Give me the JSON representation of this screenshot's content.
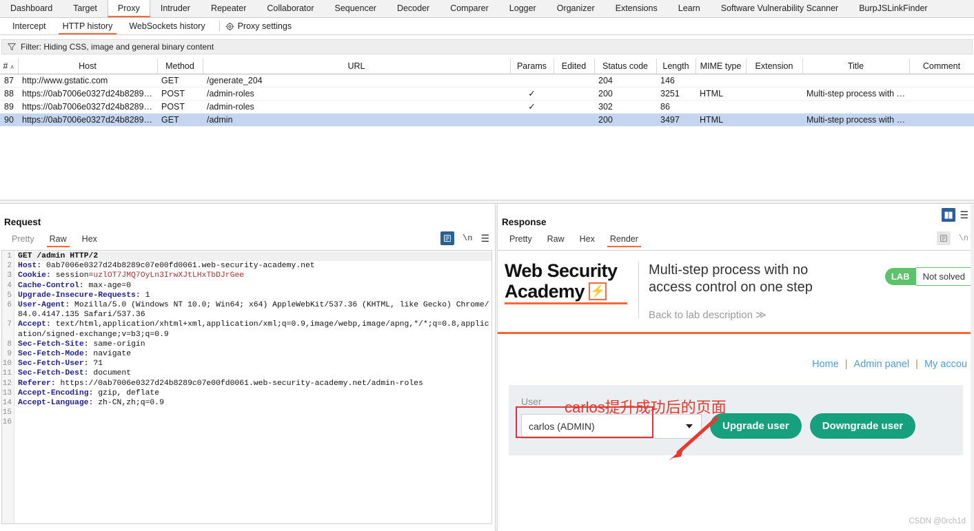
{
  "main_tabs": [
    {
      "label": "Dashboard",
      "active": false
    },
    {
      "label": "Target",
      "active": false
    },
    {
      "label": "Proxy",
      "active": true
    },
    {
      "label": "Intruder",
      "active": false
    },
    {
      "label": "Repeater",
      "active": false
    },
    {
      "label": "Collaborator",
      "active": false
    },
    {
      "label": "Sequencer",
      "active": false
    },
    {
      "label": "Decoder",
      "active": false
    },
    {
      "label": "Comparer",
      "active": false
    },
    {
      "label": "Logger",
      "active": false
    },
    {
      "label": "Organizer",
      "active": false
    },
    {
      "label": "Extensions",
      "active": false
    },
    {
      "label": "Learn",
      "active": false
    },
    {
      "label": "Software Vulnerability Scanner",
      "active": false
    },
    {
      "label": "BurpJSLinkFinder",
      "active": false
    }
  ],
  "sub_tabs": [
    {
      "label": "Intercept",
      "active": false
    },
    {
      "label": "HTTP history",
      "active": true
    },
    {
      "label": "WebSockets history",
      "active": false
    }
  ],
  "proxy_settings_label": "Proxy settings",
  "filter": {
    "icon": "funnel-icon",
    "text": "Filter: Hiding CSS, image and general binary content"
  },
  "history_table": {
    "columns": [
      "#",
      "Host",
      "Method",
      "URL",
      "Params",
      "Edited",
      "Status code",
      "Length",
      "MIME type",
      "Extension",
      "Title",
      "Comment"
    ],
    "sort_column": "#",
    "sort_direction": "asc",
    "rows": [
      {
        "num": "87",
        "host": "http://www.gstatic.com",
        "method": "GET",
        "url": "/generate_204",
        "params": "",
        "edited": "",
        "status": "204",
        "length": "146",
        "mime": "",
        "extension": "",
        "title": "",
        "comment": "",
        "selected": false
      },
      {
        "num": "88",
        "host": "https://0ab7006e0327d24b8289…",
        "method": "POST",
        "url": "/admin-roles",
        "params": "✓",
        "edited": "",
        "status": "200",
        "length": "3251",
        "mime": "HTML",
        "extension": "",
        "title": "Multi-step process with …",
        "comment": "",
        "selected": false
      },
      {
        "num": "89",
        "host": "https://0ab7006e0327d24b8289…",
        "method": "POST",
        "url": "/admin-roles",
        "params": "✓",
        "edited": "",
        "status": "302",
        "length": "86",
        "mime": "",
        "extension": "",
        "title": "",
        "comment": "",
        "selected": false
      },
      {
        "num": "90",
        "host": "https://0ab7006e0327d24b8289…",
        "method": "GET",
        "url": "/admin",
        "params": "",
        "edited": "",
        "status": "200",
        "length": "3497",
        "mime": "HTML",
        "extension": "",
        "title": "Multi-step process with …",
        "comment": "",
        "selected": true
      }
    ]
  },
  "request_pane": {
    "title": "Request",
    "tabs": [
      {
        "label": "Pretty",
        "active": false,
        "muted": true
      },
      {
        "label": "Raw",
        "active": true,
        "muted": false
      },
      {
        "label": "Hex",
        "active": false,
        "muted": false
      }
    ],
    "tools": [
      "format-icon",
      "newline-icon",
      "menu-icon"
    ],
    "lines": [
      {
        "n": "1",
        "type": "start",
        "text": "GET /admin HTTP/2"
      },
      {
        "n": "2",
        "type": "header",
        "name": "Host:",
        "value": " 0ab7006e0327d24b8289c07e00fd0061.web-security-academy.net"
      },
      {
        "n": "3",
        "type": "cookie",
        "name": "Cookie:",
        "value": " session=",
        "cookie": "uzlOT7JMQ7OyLn3IrwXJtLHxTbDJrGee"
      },
      {
        "n": "4",
        "type": "header",
        "name": "Cache-Control:",
        "value": " max-age=0"
      },
      {
        "n": "5",
        "type": "header",
        "name": "Upgrade-Insecure-Requests:",
        "value": " 1"
      },
      {
        "n": "6",
        "type": "header",
        "name": "User-Agent:",
        "value": " Mozilla/5.0 (Windows NT 10.0; Win64; x64) AppleWebKit/537.36 (KHTML, like Gecko) Chrome/84.0.4147.135 Safari/537.36"
      },
      {
        "n": "7",
        "type": "header",
        "name": "Accept:",
        "value": " text/html,application/xhtml+xml,application/xml;q=0.9,image/webp,image/apng,*/*;q=0.8,application/signed-exchange;v=b3;q=0.9"
      },
      {
        "n": "8",
        "type": "header",
        "name": "Sec-Fetch-Site:",
        "value": " same-origin"
      },
      {
        "n": "9",
        "type": "header",
        "name": "Sec-Fetch-Mode:",
        "value": " navigate"
      },
      {
        "n": "10",
        "type": "header",
        "name": "Sec-Fetch-User:",
        "value": " ?1"
      },
      {
        "n": "11",
        "type": "header",
        "name": "Sec-Fetch-Dest:",
        "value": " document"
      },
      {
        "n": "12",
        "type": "header",
        "name": "Referer:",
        "value": " https://0ab7006e0327d24b8289c07e00fd0061.web-security-academy.net/admin-roles"
      },
      {
        "n": "13",
        "type": "header",
        "name": "Accept-Encoding:",
        "value": " gzip, deflate"
      },
      {
        "n": "14",
        "type": "header",
        "name": "Accept-Language:",
        "value": " zh-CN,zh;q=0.9"
      },
      {
        "n": "15",
        "type": "blank",
        "text": ""
      },
      {
        "n": "16",
        "type": "blank",
        "text": ""
      }
    ]
  },
  "response_pane": {
    "title": "Response",
    "tabs": [
      {
        "label": "Pretty",
        "active": false
      },
      {
        "label": "Raw",
        "active": false
      },
      {
        "label": "Hex",
        "active": false
      },
      {
        "label": "Render",
        "active": true
      }
    ],
    "layout_buttons": [
      "split-view-icon",
      "menu-icon"
    ],
    "tools": [
      "format-icon",
      "newline-icon"
    ]
  },
  "rendered_page": {
    "logo_line1": "Web Security",
    "logo_line2": "Academy",
    "lab_title": "Multi-step process with no access control on one step",
    "back_link": "Back to lab description  ≫",
    "badge": "LAB",
    "status": "Not solved",
    "nav": [
      {
        "label": "Home"
      },
      {
        "label": "Admin panel"
      },
      {
        "label": "My accou"
      }
    ],
    "nav_separator": "|",
    "form": {
      "label": "User",
      "selected_user": "carlos (ADMIN)",
      "upgrade_button": "Upgrade user",
      "downgrade_button": "Downgrade user"
    },
    "annotation": "carlos提升成功后的页面",
    "annotation_color": "#e8392f",
    "watermark": "CSDN @0rch1d"
  },
  "colors": {
    "accent_orange": "#ff6633",
    "selection_blue": "#c3d5ef",
    "lab_green": "#5bc46b",
    "button_green": "#17a07e",
    "link_blue": "#4a9fe0",
    "annotation_red": "#e8392f"
  }
}
